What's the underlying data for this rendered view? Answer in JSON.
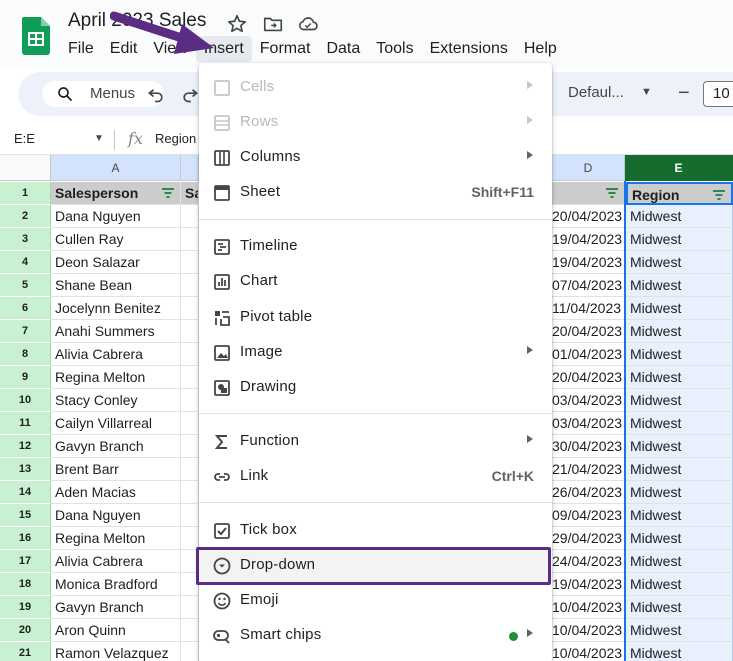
{
  "app": {
    "title": "April 2023 Sales",
    "menus": [
      "File",
      "Edit",
      "View",
      "Insert",
      "Format",
      "Data",
      "Tools",
      "Extensions",
      "Help"
    ],
    "active_menu": "Insert"
  },
  "toolbar": {
    "search_label": "Menus",
    "font_name": "Defaul...",
    "font_size": "10"
  },
  "formula_bar": {
    "name_box": "E:E",
    "content": "Region"
  },
  "columns": {
    "A": "A",
    "D": "D",
    "E": "E"
  },
  "rows": [
    {
      "num": "1",
      "a": "Salesperson",
      "b": "Sa",
      "d": "",
      "e": "Region"
    },
    {
      "num": "2",
      "a": "Dana Nguyen",
      "b": "",
      "d": "20/04/2023",
      "e": "Midwest"
    },
    {
      "num": "3",
      "a": "Cullen Ray",
      "b": "",
      "d": "19/04/2023",
      "e": "Midwest"
    },
    {
      "num": "4",
      "a": "Deon Salazar",
      "b": "",
      "d": "19/04/2023",
      "e": "Midwest"
    },
    {
      "num": "5",
      "a": "Shane Bean",
      "b": "",
      "d": "07/04/2023",
      "e": "Midwest"
    },
    {
      "num": "6",
      "a": "Jocelynn Benitez",
      "b": "",
      "d": "11/04/2023",
      "e": "Midwest"
    },
    {
      "num": "7",
      "a": "Anahi Summers",
      "b": "",
      "d": "20/04/2023",
      "e": "Midwest"
    },
    {
      "num": "8",
      "a": "Alivia Cabrera",
      "b": "",
      "d": "01/04/2023",
      "e": "Midwest"
    },
    {
      "num": "9",
      "a": "Regina Melton",
      "b": "",
      "d": "20/04/2023",
      "e": "Midwest"
    },
    {
      "num": "10",
      "a": "Stacy Conley",
      "b": "",
      "d": "03/04/2023",
      "e": "Midwest"
    },
    {
      "num": "11",
      "a": "Cailyn Villarreal",
      "b": "",
      "d": "03/04/2023",
      "e": "Midwest"
    },
    {
      "num": "12",
      "a": "Gavyn Branch",
      "b": "",
      "d": "30/04/2023",
      "e": "Midwest"
    },
    {
      "num": "13",
      "a": "Brent Barr",
      "b": "",
      "d": "21/04/2023",
      "e": "Midwest"
    },
    {
      "num": "14",
      "a": "Aden Macias",
      "b": "",
      "d": "26/04/2023",
      "e": "Midwest"
    },
    {
      "num": "15",
      "a": "Dana Nguyen",
      "b": "",
      "d": "09/04/2023",
      "e": "Midwest"
    },
    {
      "num": "16",
      "a": "Regina Melton",
      "b": "",
      "d": "29/04/2023",
      "e": "Midwest"
    },
    {
      "num": "17",
      "a": "Alivia Cabrera",
      "b": "",
      "d": "24/04/2023",
      "e": "Midwest"
    },
    {
      "num": "18",
      "a": "Monica Bradford",
      "b": "",
      "d": "19/04/2023",
      "e": "Midwest"
    },
    {
      "num": "19",
      "a": "Gavyn Branch",
      "b": "",
      "d": "10/04/2023",
      "e": "Midwest"
    },
    {
      "num": "20",
      "a": "Aron Quinn",
      "b": "",
      "d": "10/04/2023",
      "e": "Midwest"
    },
    {
      "num": "21",
      "a": "Ramon Velazquez",
      "b": "",
      "d": "10/04/2023",
      "e": "Midwest"
    }
  ],
  "insert_menu": {
    "items": [
      {
        "label": "Cells",
        "icon": "cells-icon",
        "submenu": true,
        "disabled": true
      },
      {
        "label": "Rows",
        "icon": "rows-icon",
        "submenu": true,
        "disabled": true
      },
      {
        "label": "Columns",
        "icon": "columns-icon",
        "submenu": true
      },
      {
        "label": "Sheet",
        "icon": "sheet-icon",
        "shortcut": "Shift+F11"
      },
      {
        "label": "Timeline",
        "icon": "timeline-icon"
      },
      {
        "label": "Chart",
        "icon": "chart-icon"
      },
      {
        "label": "Pivot table",
        "icon": "pivot-table-icon"
      },
      {
        "label": "Image",
        "icon": "image-icon",
        "submenu": true
      },
      {
        "label": "Drawing",
        "icon": "drawing-icon"
      },
      {
        "label": "Function",
        "icon": "function-icon",
        "submenu": true
      },
      {
        "label": "Link",
        "icon": "link-icon",
        "shortcut": "Ctrl+K"
      },
      {
        "label": "Tick box",
        "icon": "tick-box-icon"
      },
      {
        "label": "Drop-down",
        "icon": "drop-down-icon",
        "highlighted": true
      },
      {
        "label": "Emoji",
        "icon": "emoji-icon"
      },
      {
        "label": "Smart chips",
        "icon": "smart-chips-icon",
        "submenu": true,
        "badge": "green-dot"
      }
    ]
  },
  "colors": {
    "brand_green": "#0f9d58",
    "active_column": "#146c2e",
    "row_header": "#c9f0d1",
    "selection": "#1a73e8",
    "annotation": "#5b2c83"
  }
}
